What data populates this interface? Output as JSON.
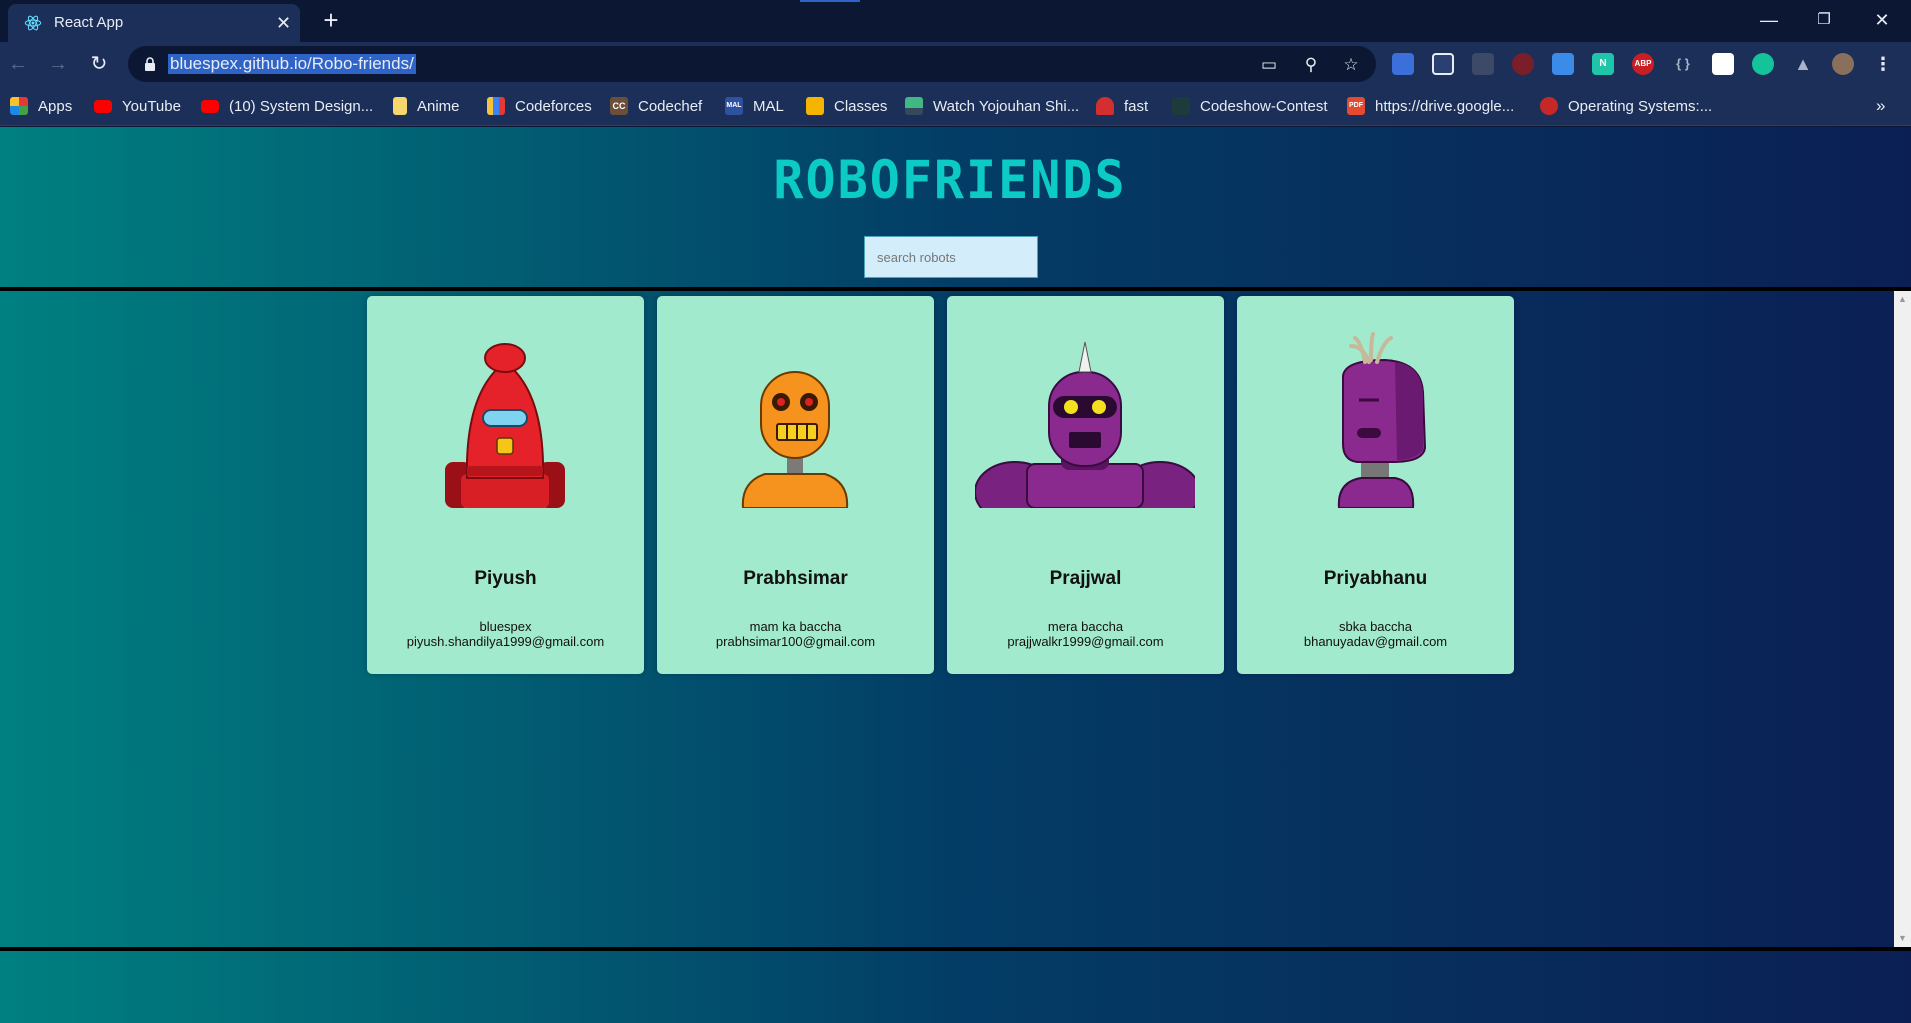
{
  "browser": {
    "tab_title": "React App",
    "tab_close": "✕",
    "new_tab": "+",
    "url": "bluespex.github.io/Robo-friends/",
    "window_controls": {
      "minimize": "—",
      "restore": "❐",
      "close": "✕"
    },
    "toolbar_icons": [
      "back-icon",
      "forward-icon",
      "reload-icon",
      "lock-icon",
      "cast-icon",
      "zoom-icon",
      "star-icon",
      "extensions-icon",
      "profile-avatar",
      "menu-icon"
    ],
    "extension_labels": {
      "abp": "ABP",
      "braces": "{ }",
      "n": "N"
    },
    "bookmarks": [
      {
        "label": "Apps",
        "icon": "apps-grid-icon",
        "color": "#e53935"
      },
      {
        "label": "YouTube",
        "icon": "youtube-icon",
        "color": "#ff0000"
      },
      {
        "label": "(10) System Design...",
        "icon": "youtube-icon",
        "color": "#ff0000"
      },
      {
        "label": "Anime",
        "icon": "file-icon",
        "color": "#f5d76e"
      },
      {
        "label": "Codeforces",
        "icon": "codeforces-icon",
        "color": "#3b82f6"
      },
      {
        "label": "Codechef",
        "icon": "codechef-icon",
        "color": "#6b4f3a"
      },
      {
        "label": "MAL",
        "icon": "mal-icon",
        "color": "#2e51a2"
      },
      {
        "label": "Classes",
        "icon": "classroom-icon",
        "color": "#f4b400"
      },
      {
        "label": "Watch Yojouhan Shi...",
        "icon": "vue-icon",
        "color": "#41b883"
      },
      {
        "label": "fast",
        "icon": "speed-icon",
        "color": "#d32f2f"
      },
      {
        "label": "Codeshow-Contest",
        "icon": "code-icon",
        "color": "#1e3b3b"
      },
      {
        "label": "https://drive.google...",
        "icon": "pdf-icon",
        "color": "#e34a2f"
      },
      {
        "label": "Operating Systems:...",
        "icon": "os-icon",
        "color": "#c62828"
      }
    ],
    "bookmark_icon_text": {
      "codechef": "CC",
      "mal": "MAL",
      "pdf": "PDF"
    },
    "bookmarks_overflow": "»"
  },
  "page": {
    "title": "ROBOFRIENDS",
    "search_placeholder": "search robots",
    "robots": [
      {
        "name": "Piyush",
        "tagline": "bluespex",
        "email": "piyush.shandilya1999@gmail.com",
        "color": "#e52229"
      },
      {
        "name": "Prabhsimar",
        "tagline": "mam ka baccha",
        "email": "prabhsimar100@gmail.com",
        "color": "#f5931e"
      },
      {
        "name": "Prajjwal",
        "tagline": "mera baccha",
        "email": "prajjwalkr1999@gmail.com",
        "color": "#8a2a8e"
      },
      {
        "name": "Priyabhanu",
        "tagline": "sbka baccha",
        "email": "bhanuyadav@gmail.com",
        "color": "#8a2a8e"
      }
    ]
  },
  "colors": {
    "title": "#0ccac4",
    "card_bg": "#a2eacd",
    "url_highlight": "#2e63c8",
    "chrome_bg": "#1b2f58"
  }
}
